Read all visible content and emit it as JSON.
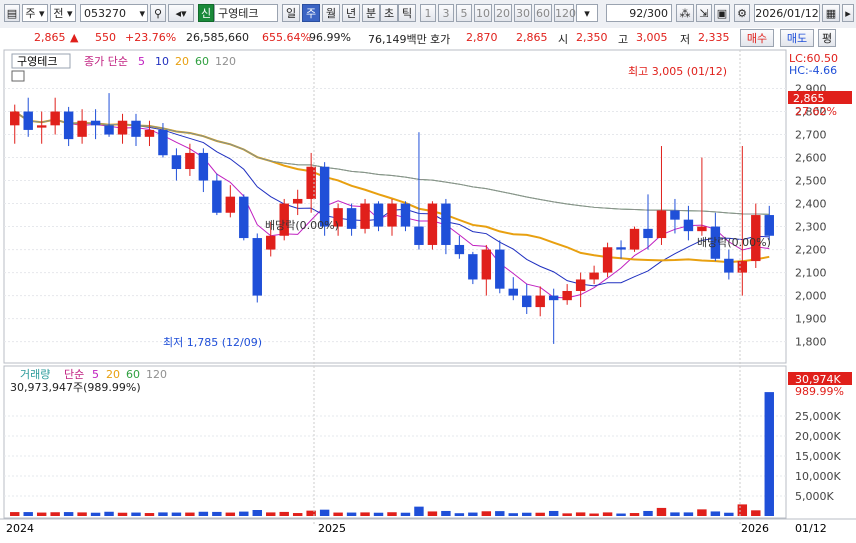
{
  "toolbar": {
    "market": "주",
    "jeon": "전",
    "code": "053270",
    "sin_badge": "신",
    "stock_name": "구영테크",
    "periods": [
      "일",
      "주",
      "월",
      "년",
      "분",
      "초",
      "틱"
    ],
    "active_period": "주",
    "intervals": [
      "1",
      "3",
      "5",
      "10",
      "20",
      "30",
      "60",
      "120"
    ],
    "count": "92",
    "count_total": "/300",
    "date": "2026/01/12"
  },
  "info": {
    "price": "2,865",
    "change_arrow": "▲",
    "change": "550",
    "change_pct": "+23.76%",
    "volume": "26,585,660",
    "vol_pct": "655.64%",
    "ratio": "96.99%",
    "amount": "76,149백만",
    "ask_label": "호가",
    "ask": "2,870",
    "bid": "2,865",
    "open_label": "시",
    "open": "2,350",
    "high_label": "고",
    "high": "3,005",
    "low_label": "저",
    "low": "2,335",
    "buy": "매수",
    "sell": "매도",
    "eval": "평"
  },
  "price_panel": {
    "name": "구영테크",
    "ma_title": "종가 단순",
    "ma_periods": [
      "5",
      "10",
      "20",
      "60",
      "120"
    ],
    "ma_colors": [
      "#c020c0",
      "#2030c0",
      "#e8a010",
      "#30a040",
      "#909090"
    ],
    "lc": "LC:60.50",
    "hc": "HC:-4.66",
    "last_price": "2,865",
    "last_pct": "27.62%",
    "high_annot": "최고 3,005 (01/12)",
    "low_annot": "최저 1,785 (12/09)",
    "div1": "배당락(0.00%)",
    "div2": "배당락(0.00%)"
  },
  "volume_panel": {
    "title": "거래량",
    "ma_title": "단순",
    "ma_periods": [
      "5",
      "20",
      "60",
      "120"
    ],
    "current": "30,973,947주(989.99%)",
    "last_label": "30,974K",
    "last_pct": "989.99%"
  },
  "x_labels": [
    "2024",
    "2025",
    "2026"
  ],
  "x_right": "01/12",
  "chart_data": {
    "type": "candlestick",
    "y_ticks": [
      1800,
      1900,
      2000,
      2100,
      2200,
      2300,
      2400,
      2500,
      2600,
      2700,
      2800,
      2900
    ],
    "ylim": [
      1720,
      3050
    ],
    "vol_ticks": [
      "5,000K",
      "10,000K",
      "15,000K",
      "20,000K",
      "25,000K"
    ],
    "vol_max_k": 32000,
    "ohlc": [
      [
        2740,
        2830,
        2660,
        2800
      ],
      [
        2800,
        2860,
        2690,
        2720
      ],
      [
        2730,
        2800,
        2660,
        2740
      ],
      [
        2740,
        2860,
        2700,
        2800
      ],
      [
        2800,
        2820,
        2650,
        2680
      ],
      [
        2690,
        2810,
        2660,
        2760
      ],
      [
        2760,
        2810,
        2680,
        2740
      ],
      [
        2740,
        2880,
        2690,
        2700
      ],
      [
        2700,
        2790,
        2660,
        2760
      ],
      [
        2760,
        2790,
        2650,
        2690
      ],
      [
        2690,
        2760,
        2650,
        2720
      ],
      [
        2720,
        2750,
        2600,
        2610
      ],
      [
        2610,
        2640,
        2500,
        2550
      ],
      [
        2550,
        2660,
        2520,
        2620
      ],
      [
        2620,
        2640,
        2450,
        2500
      ],
      [
        2500,
        2530,
        2350,
        2360
      ],
      [
        2360,
        2480,
        2340,
        2430
      ],
      [
        2430,
        2440,
        2240,
        2250
      ],
      [
        2250,
        2270,
        1970,
        2000
      ],
      [
        2200,
        2320,
        2170,
        2260
      ],
      [
        2260,
        2420,
        2240,
        2400
      ],
      [
        2400,
        2460,
        2350,
        2420
      ],
      [
        2420,
        2620,
        2360,
        2560
      ],
      [
        2560,
        2580,
        2260,
        2300
      ],
      [
        2300,
        2400,
        2260,
        2380
      ],
      [
        2380,
        2400,
        2260,
        2290
      ],
      [
        2290,
        2420,
        2270,
        2400
      ],
      [
        2400,
        2410,
        2280,
        2300
      ],
      [
        2300,
        2420,
        2260,
        2400
      ],
      [
        2400,
        2410,
        2280,
        2300
      ],
      [
        2300,
        2710,
        2200,
        2220
      ],
      [
        2220,
        2410,
        2200,
        2400
      ],
      [
        2400,
        2420,
        2180,
        2220
      ],
      [
        2220,
        2260,
        2160,
        2180
      ],
      [
        2180,
        2190,
        2050,
        2070
      ],
      [
        2070,
        2220,
        2000,
        2200
      ],
      [
        2200,
        2240,
        2010,
        2030
      ],
      [
        2030,
        2080,
        1980,
        2000
      ],
      [
        2000,
        2050,
        1920,
        1950
      ],
      [
        1950,
        2040,
        1910,
        2000
      ],
      [
        2000,
        2030,
        1790,
        1980
      ],
      [
        1980,
        2050,
        1960,
        2020
      ],
      [
        2020,
        2100,
        1950,
        2070
      ],
      [
        2070,
        2130,
        2050,
        2100
      ],
      [
        2100,
        2230,
        2080,
        2210
      ],
      [
        2210,
        2240,
        2160,
        2200
      ],
      [
        2200,
        2300,
        2190,
        2290
      ],
      [
        2290,
        2440,
        2200,
        2250
      ],
      [
        2250,
        2650,
        2220,
        2370
      ],
      [
        2370,
        2420,
        2270,
        2330
      ],
      [
        2330,
        2390,
        2240,
        2280
      ],
      [
        2280,
        2600,
        2260,
        2300
      ],
      [
        2300,
        2360,
        2150,
        2160
      ],
      [
        2160,
        2200,
        2070,
        2100
      ],
      [
        2100,
        2650,
        2000,
        2150
      ],
      [
        2150,
        2400,
        2120,
        2350
      ],
      [
        2350,
        2390,
        2240,
        2260
      ]
    ]
  }
}
